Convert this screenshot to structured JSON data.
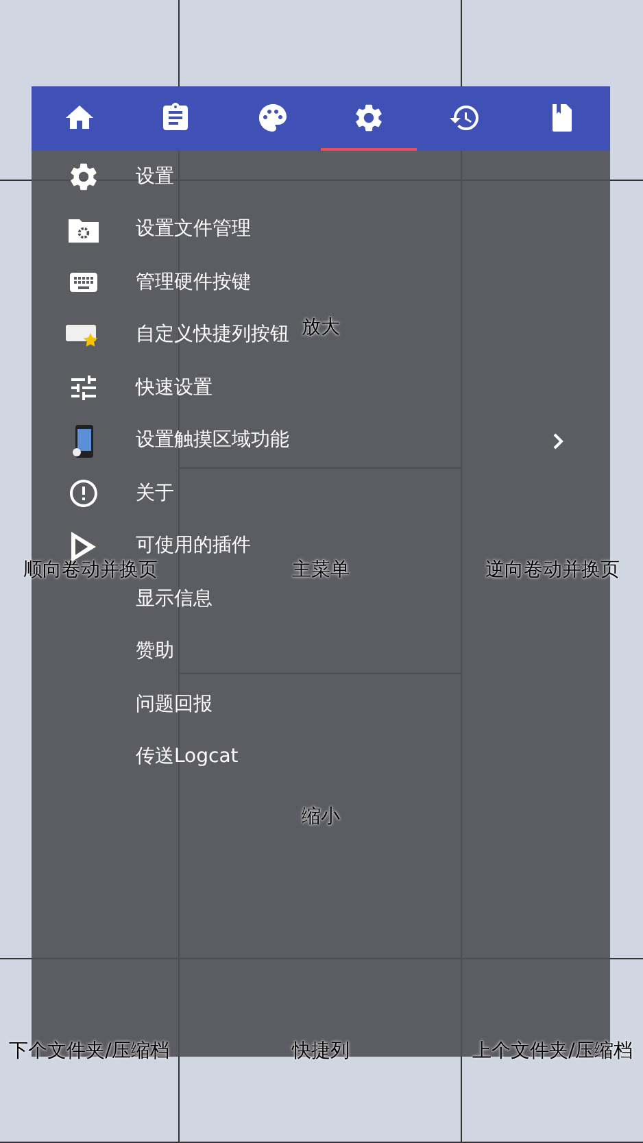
{
  "tabs": [
    {
      "kind": "home",
      "selected": false
    },
    {
      "kind": "clipboard",
      "selected": false
    },
    {
      "kind": "palette",
      "selected": false
    },
    {
      "kind": "gear",
      "selected": true
    },
    {
      "kind": "history",
      "selected": false
    },
    {
      "kind": "bookmark",
      "selected": false
    }
  ],
  "menu_items": [
    {
      "kind": "gear",
      "label": "设置",
      "submenu": false
    },
    {
      "kind": "folder",
      "label": "设置文件管理",
      "submenu": false
    },
    {
      "kind": "keyboard",
      "label": "管理硬件按键",
      "submenu": false
    },
    {
      "kind": "card",
      "label": "自定义快捷列按钮",
      "submenu": false
    },
    {
      "kind": "sliders",
      "label": "快速设置",
      "submenu": false
    },
    {
      "kind": "phone",
      "label": "设置触摸区域功能",
      "submenu": true
    },
    {
      "kind": "info",
      "label": "关于",
      "submenu": false
    },
    {
      "kind": "play",
      "label": "可使用的插件",
      "submenu": false
    },
    {
      "kind": "plain",
      "label": "显示信息",
      "submenu": false
    },
    {
      "kind": "plain",
      "label": "赞助",
      "submenu": false
    },
    {
      "kind": "plain",
      "label": "问题回报",
      "submenu": false
    },
    {
      "kind": "plain",
      "label": "传送Logcat",
      "submenu": false
    }
  ],
  "touch_zones": {
    "zoom_in": "放大",
    "left": "顺向卷动并换页",
    "center": "主菜单",
    "right": "逆向卷动并换页",
    "zoom_out": "缩小",
    "bottom_left": "下个文件夹/压缩档",
    "bottom_center": "快捷列",
    "bottom_right": "上个文件夹/压缩档"
  }
}
